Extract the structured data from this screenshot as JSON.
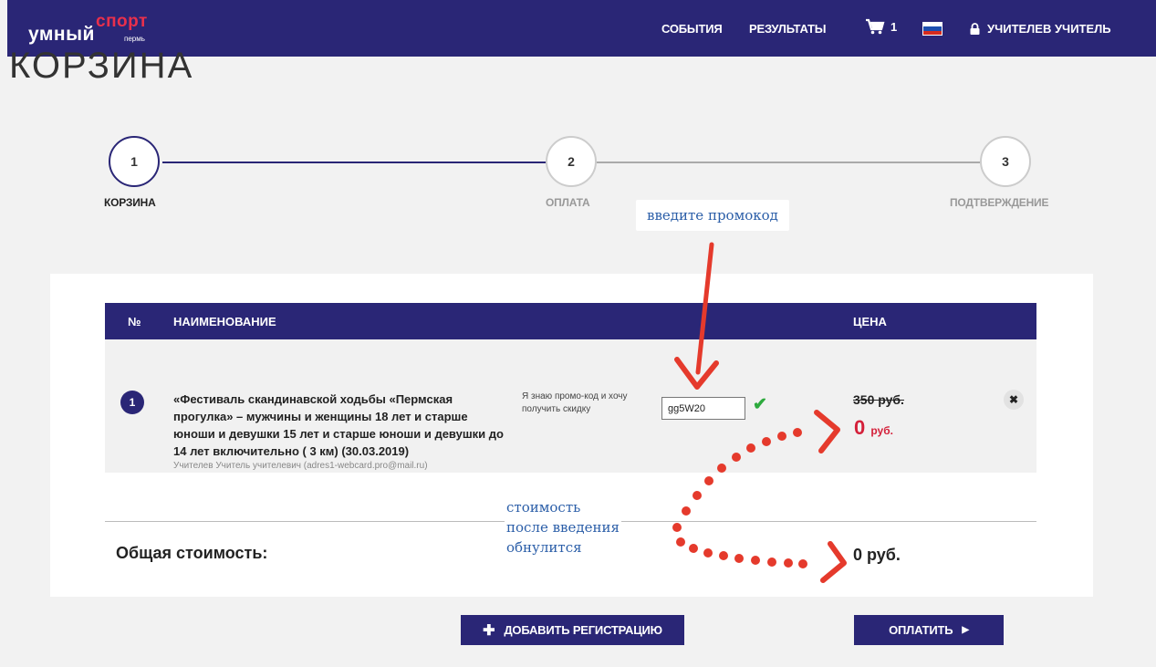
{
  "nav": {
    "logo_main": "умный",
    "logo_sport": "спорт",
    "logo_city": "пермь",
    "events": "СОБЫТИЯ",
    "results": "РЕЗУЛЬТАТЫ",
    "cart_count": "1",
    "user_name": "УЧИТЕЛЕВ УЧИТЕЛЬ"
  },
  "page": {
    "title": "КОРЗИНА"
  },
  "steps": [
    {
      "num": "1",
      "label": "КОРЗИНА"
    },
    {
      "num": "2",
      "label": "ОПЛАТА"
    },
    {
      "num": "3",
      "label": "ПОДТВЕРЖДЕНИЕ"
    }
  ],
  "annotations": {
    "promo_hint": "введите промокод",
    "cost_note_1": "стоимость",
    "cost_note_2": "после введения",
    "cost_note_3": "обнулится"
  },
  "table": {
    "col_num": "№",
    "col_name": "НАИМЕНОВАНИЕ",
    "col_price": "ЦЕНА",
    "rows": [
      {
        "num": "1",
        "title": "«Фестиваль скандинавской ходьбы «Пермская прогулка» – мужчины и женщины 18 лет и старше юноши и девушки 15 лет и старше юноши и девушки до 14 лет включительно ( 3 км) (30.03.2019)",
        "user": "Учителев Учитель учителевич (adres1-webcard.pro@mail.ru)",
        "promo_label": "Я знаю промо-код и хочу получить скидку",
        "promo_value": "gg5W20",
        "old_price": "350 руб.",
        "new_price": "0",
        "currency": "руб."
      }
    ]
  },
  "summary": {
    "total_label": "Общая стоимость:",
    "total_value": "0 руб."
  },
  "actions": {
    "add_registration": "ДОБАВИТЬ РЕГИСТРАЦИЮ",
    "pay": "ОПЛАТИТЬ"
  },
  "colors": {
    "brand": "#2a2676",
    "accent": "#e9304c",
    "price_red": "#d4203a",
    "annotation": "#2b5ea8"
  }
}
